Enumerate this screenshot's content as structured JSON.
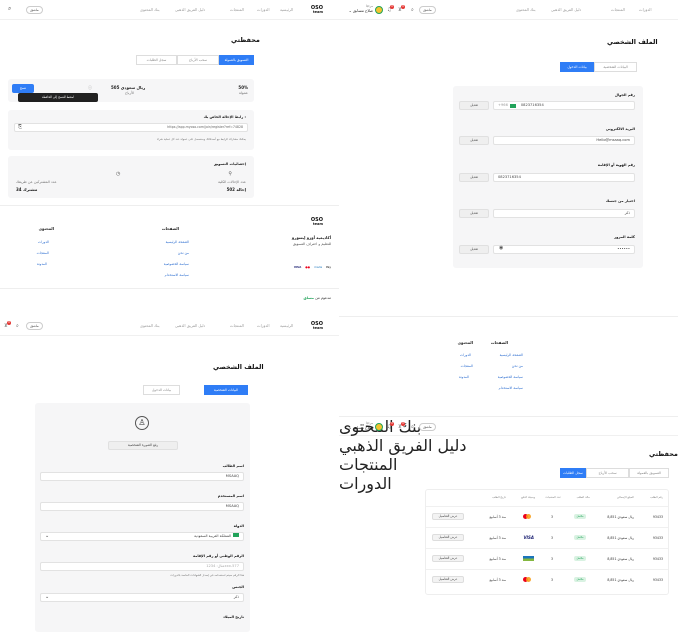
{
  "nav": {
    "links_a": [
      "الرئيسية",
      "الدورات",
      "المنتجات",
      "دليل الفريق الذهبي",
      "بنك المحتوى"
    ],
    "links_b": [
      "الدورات",
      "المنتجات",
      "دليل الفريق الذهبي",
      "بنك المحتوى"
    ],
    "login": "ماشق",
    "user_greeting": "مرحبًا",
    "user_name": "صلاح مسابق",
    "cart_count": "0",
    "wishlist_count": "0"
  },
  "logo": {
    "line1": "OSO",
    "line2": "team"
  },
  "wallet": {
    "title": "محفظتي",
    "tabs": [
      "التسويق بالعمولة",
      "سحب الأرباح",
      "سجل الطلبات"
    ],
    "percent": "50%",
    "percent_label": "عمولة",
    "amount": "505 ريال سعودي",
    "amount_label": "الأرباح",
    "tooltip": "اضغط للنسخ إلى الحافظة",
    "copy_btn": "نسخ",
    "referral_label": "رابط الإحالة الخاص بك :",
    "referral_url": "https://app.myoso.com/join/register?ref=74828",
    "referral_hint": "يمكنك مشاركة الرابط مع أصدقائك وستحصل على عمولة عند كل عملية شراء",
    "stats_title": "إحصائيات التسويق",
    "stat1_label": "عدد الإحالات الكلية",
    "stat1_value": "502 إحالة",
    "stat2_label": "عدد المشتركين عن طريقك",
    "stat2_value": "34 مشترك"
  },
  "footer": {
    "brand_title": "أكاديمية أوزو إيسورو",
    "brand_text": "للتعليم و احتراف التسويق",
    "col1_title": "الصفحات",
    "col1_links": [
      "الصفحة الرئيسية",
      "من نحن",
      "سياسة الخصوصية",
      "سياسة الاستخدام"
    ],
    "col2_title": "المحتوى",
    "col2_links": [
      "الدورات",
      "المنتجات",
      "المدونة"
    ],
    "powered": "مدعوم من",
    "powered_brand": "مساق",
    "payments": [
      "Pay",
      "mada",
      "MC",
      "VISA"
    ]
  },
  "profile": {
    "title": "الملف الشخصي",
    "tab_personal": "البيانات الشخصية",
    "tab_login": "بيانات الدخول",
    "phone_label": "رقم الجوال",
    "phone_value": "0823716354",
    "phone_code": "+966",
    "email_label": "البريد الالكتروني",
    "email_value": "Hello@msaaq.com",
    "id_label": "رقم الهوية أو الإقامة",
    "id_value": "0823716354",
    "gender_label": "اختيار من جنسك",
    "gender_value": "ذكر",
    "password_label": "كلمة المرور",
    "password_value": "••••••",
    "edit_btn": "تعديل",
    "upload_btn": "رفع الصورة الشخصية",
    "student_label": "اسم الطالب",
    "student_value": "MSAAQ",
    "username_label": "اسم المستخدم",
    "username_value": "MSAAQ",
    "country_label": "الدولة",
    "country_value": "المملكة العربية السعودية",
    "nid_label": "الرقم الوطني أو رقم الإقامة",
    "nid_placeholder": "مثال: 1234xxx-577",
    "nid_hint": "هذا الرقم سيتم استخدامه في إصدار الشهادات الخاصة بالدورات",
    "gender2_label": "الجنس",
    "birth_label": "تاريخ الميلاد"
  },
  "orders": {
    "headers": [
      "رقم الطلب",
      "المبلغ الإجمالي",
      "حالة الطلب",
      "عدد المنتجات",
      "وسيلة الدفع",
      "تاريخ الطلب"
    ],
    "rows": [
      {
        "id": "93433",
        "amount": "8,851 ريال سعودي",
        "status": "مكتمل",
        "count": "3",
        "pay": "mc",
        "date": "منذ 3 أسابيع",
        "action": "عرض التفاصيل"
      },
      {
        "id": "93433",
        "amount": "8,851 ريال سعودي",
        "status": "مكتمل",
        "count": "3",
        "pay": "visa",
        "date": "منذ 3 أسابيع",
        "action": "عرض التفاصيل"
      },
      {
        "id": "93433",
        "amount": "8,851 ريال سعودي",
        "status": "مكتمل",
        "count": "3",
        "pay": "mada",
        "date": "منذ 3 أسابيع",
        "action": "عرض التفاصيل"
      },
      {
        "id": "93433",
        "amount": "8,851 ريال سعودي",
        "status": "مكتمل",
        "count": "3",
        "pay": "mc",
        "date": "منذ 3 أسابيع",
        "action": "عرض التفاصيل"
      }
    ]
  },
  "colors": {
    "primary": "#2f7df6",
    "success": "#21a35a",
    "danger": "#e53935"
  }
}
